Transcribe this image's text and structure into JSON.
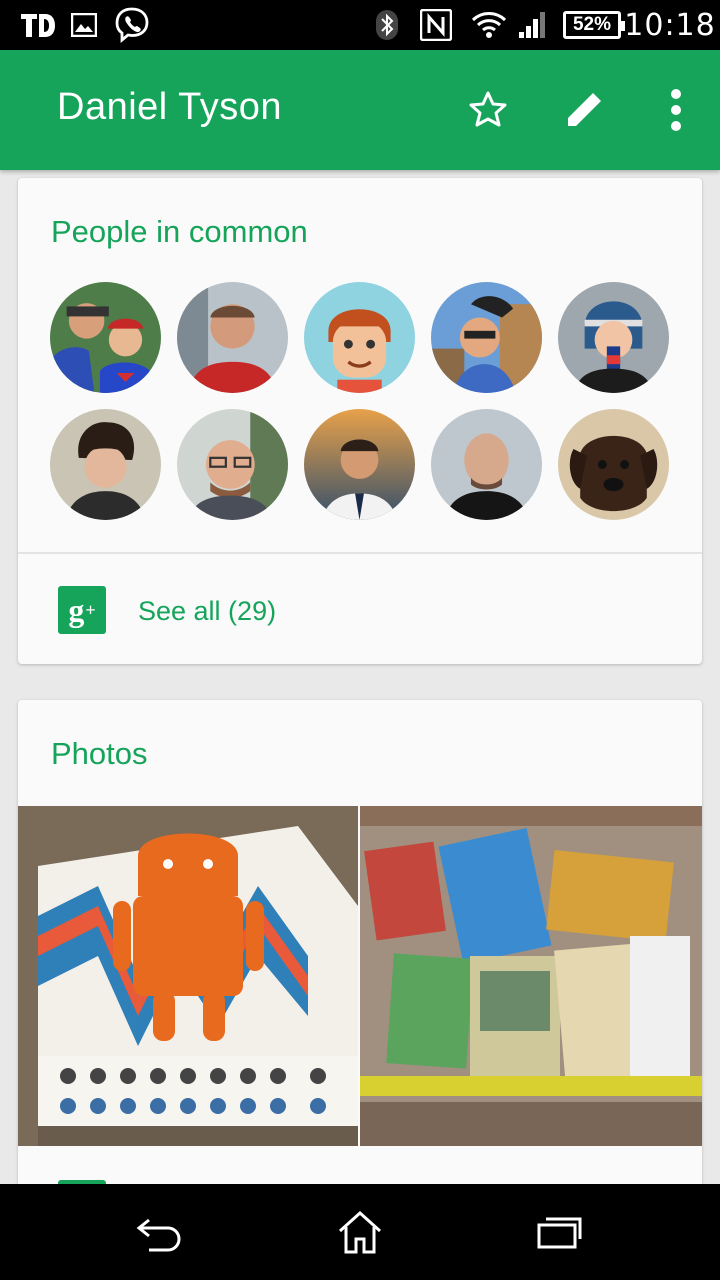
{
  "status_bar": {
    "icons": [
      "td-app-icon",
      "image-icon",
      "viber-icon",
      "bluetooth-icon",
      "nfc-icon",
      "wifi-icon",
      "cell-signal-icon"
    ],
    "battery": "52%",
    "time": "10:18"
  },
  "app_bar": {
    "title": "Daniel Tyson",
    "actions": [
      "star-icon",
      "edit-pencil-icon",
      "overflow-menu-icon"
    ]
  },
  "people_card": {
    "title": "People in common",
    "avatar_count_shown": 10,
    "see_all_label": "See all (29)",
    "source_icon": "google-plus-icon"
  },
  "photos_card": {
    "title": "Photos",
    "photos": [
      "android-figure-box-photo",
      "trading-cards-bag-photo"
    ]
  },
  "nav_bar": {
    "buttons": [
      "back-icon",
      "home-icon",
      "recents-icon"
    ]
  },
  "colors": {
    "accent": "#16a45b",
    "status_bar": "#000000",
    "card_bg": "#fafafa",
    "page_bg": "#e9e9e9"
  }
}
